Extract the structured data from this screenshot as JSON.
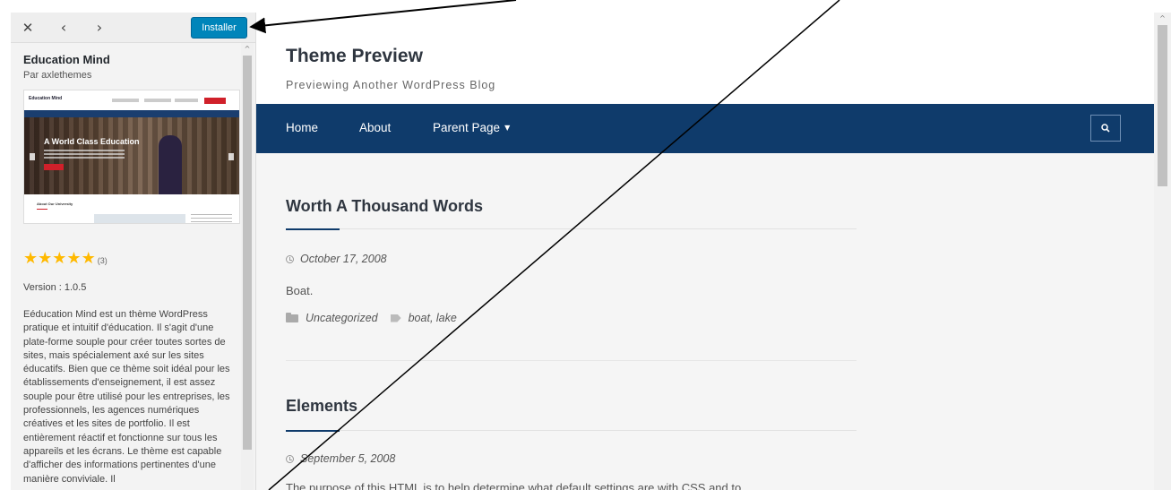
{
  "toolbar": {
    "close_icon": "close-icon",
    "prev_icon": "chevron-left-icon",
    "next_icon": "chevron-right-icon",
    "install_label": "Installer",
    "install_color": "#0085ba"
  },
  "theme": {
    "name": "Education Mind",
    "author": "Par axlethemes",
    "screenshot": {
      "logo": "Education Mind",
      "hero_title": "A World Class Education",
      "about_heading": "About Our University"
    },
    "rating": {
      "stars": 5,
      "max": 5,
      "count_label": "(3)"
    },
    "version": "Version : 1.0.5",
    "description": "Eéducation Mind est un thème WordPress pratique et intuitif d'éducation. Il s'agit d'une plate-forme souple pour créer toutes sortes de sites, mais spécialement axé sur les sites éducatifs. Bien que ce thème soit idéal pour les établissements d'enseignement, il est assez souple pour être utilisé pour les entreprises, les professionnels, les agences numériques créatives et les sites de portfolio. Il est entièrement réactif et fonctionne sur tous les appareils et les écrans. Le thème est capable d'afficher des informations pertinentes d'une manière conviviale. Il"
  },
  "site": {
    "title": "Theme Preview",
    "description": "Previewing Another WordPress Blog",
    "nav": [
      {
        "label": "Home"
      },
      {
        "label": "About"
      },
      {
        "label": "Parent Page",
        "has_dropdown": true
      }
    ],
    "nav_color": "#0f3b6b",
    "search_icon": "search-icon"
  },
  "posts": [
    {
      "title": "Worth A Thousand Words",
      "date": "October 17, 2008",
      "body": "Boat.",
      "category": "Uncategorized",
      "tags": "boat, lake"
    },
    {
      "title": "Elements",
      "date": "September 5, 2008",
      "body": "The purpose of this HTML is to help determine what default settings are with CSS and to"
    }
  ]
}
